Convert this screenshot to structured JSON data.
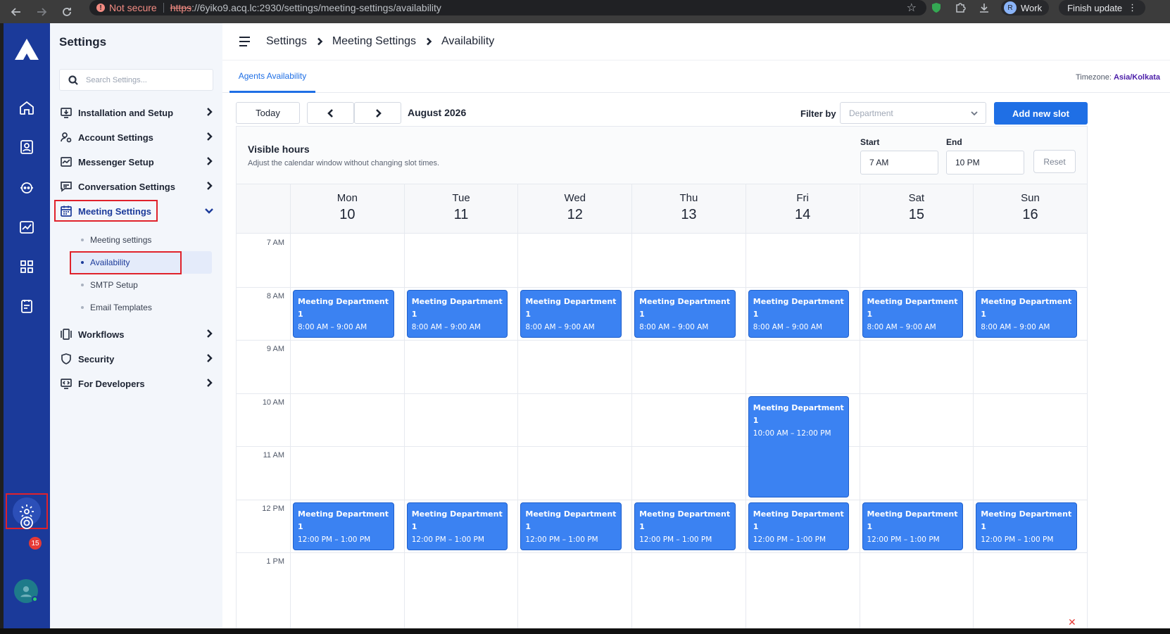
{
  "browser": {
    "security_label": "Not secure",
    "url_scheme": "https",
    "url_rest": "://6yiko9.acq.lc:2930/settings/meeting-settings/availability",
    "profile_initial": "R",
    "profile_name": "Work",
    "update_label": "Finish update"
  },
  "rail": {
    "notification_count": "15"
  },
  "settings": {
    "title": "Settings",
    "search_placeholder": "Search Settings...",
    "items": [
      {
        "label": "Installation and Setup"
      },
      {
        "label": "Account Settings"
      },
      {
        "label": "Messenger Setup"
      },
      {
        "label": "Conversation Settings"
      },
      {
        "label": "Meeting Settings"
      },
      {
        "label": "Workflows"
      },
      {
        "label": "Security"
      },
      {
        "label": "For Developers"
      }
    ],
    "sub_items": [
      {
        "label": "Meeting settings"
      },
      {
        "label": "Availability"
      },
      {
        "label": "SMTP Setup"
      },
      {
        "label": "Email Templates"
      }
    ]
  },
  "breadcrumb": [
    "Settings",
    "Meeting Settings",
    "Availability"
  ],
  "tabs": [
    {
      "label": "Agents Availability"
    }
  ],
  "timezone": {
    "label": "Timezone:",
    "value": "Asia/Kolkata"
  },
  "toolbar": {
    "today": "Today",
    "month": "August 2026",
    "filter_label": "Filter by",
    "filter_placeholder": "Department",
    "add_slot": "Add new slot"
  },
  "visible_hours": {
    "title": "Visible hours",
    "subtitle": "Adjust the calendar window without changing slot times.",
    "start_label": "Start",
    "start_value": "7 AM",
    "end_label": "End",
    "end_value": "10 PM",
    "reset": "Reset"
  },
  "days": [
    {
      "name": "Mon",
      "date": "10"
    },
    {
      "name": "Tue",
      "date": "11"
    },
    {
      "name": "Wed",
      "date": "12"
    },
    {
      "name": "Thu",
      "date": "13"
    },
    {
      "name": "Fri",
      "date": "14"
    },
    {
      "name": "Sat",
      "date": "15"
    },
    {
      "name": "Sun",
      "date": "16"
    }
  ],
  "hours": [
    "7 AM",
    "8 AM",
    "9 AM",
    "10 AM",
    "11 AM",
    "12 PM",
    "1 PM"
  ],
  "events": [
    {
      "day": 0,
      "start": 8,
      "end": 9,
      "title": "Meeting Department 1",
      "time": "8:00 AM – 9:00 AM"
    },
    {
      "day": 1,
      "start": 8,
      "end": 9,
      "title": "Meeting Department 1",
      "time": "8:00 AM – 9:00 AM"
    },
    {
      "day": 2,
      "start": 8,
      "end": 9,
      "title": "Meeting Department 1",
      "time": "8:00 AM – 9:00 AM"
    },
    {
      "day": 3,
      "start": 8,
      "end": 9,
      "title": "Meeting Department 1",
      "time": "8:00 AM – 9:00 AM"
    },
    {
      "day": 4,
      "start": 8,
      "end": 9,
      "title": "Meeting Department 1",
      "time": "8:00 AM – 9:00 AM"
    },
    {
      "day": 5,
      "start": 8,
      "end": 9,
      "title": "Meeting Department 1",
      "time": "8:00 AM – 9:00 AM"
    },
    {
      "day": 6,
      "start": 8,
      "end": 9,
      "title": "Meeting Department 1",
      "time": "8:00 AM – 9:00 AM"
    },
    {
      "day": 4,
      "start": 10,
      "end": 12,
      "title": "Meeting Department 1",
      "time": "10:00 AM – 12:00 PM"
    },
    {
      "day": 0,
      "start": 12,
      "end": 13,
      "title": "Meeting Department 1",
      "time": "12:00 PM – 1:00 PM"
    },
    {
      "day": 1,
      "start": 12,
      "end": 13,
      "title": "Meeting Department 1",
      "time": "12:00 PM – 1:00 PM"
    },
    {
      "day": 2,
      "start": 12,
      "end": 13,
      "title": "Meeting Department 1",
      "time": "12:00 PM – 1:00 PM"
    },
    {
      "day": 3,
      "start": 12,
      "end": 13,
      "title": "Meeting Department 1",
      "time": "12:00 PM – 1:00 PM"
    },
    {
      "day": 4,
      "start": 12,
      "end": 13,
      "title": "Meeting Department 1",
      "time": "12:00 PM – 1:00 PM"
    },
    {
      "day": 5,
      "start": 12,
      "end": 13,
      "title": "Meeting Department 1",
      "time": "12:00 PM – 1:00 PM"
    },
    {
      "day": 6,
      "start": 12,
      "end": 13,
      "title": "Meeting Department 1",
      "time": "12:00 PM – 1:00 PM"
    }
  ],
  "colors": {
    "rail": "#1b3a9a",
    "accent": "#1f6fe5",
    "event": "#3b82f2",
    "highlight_box": "#e0222b"
  }
}
